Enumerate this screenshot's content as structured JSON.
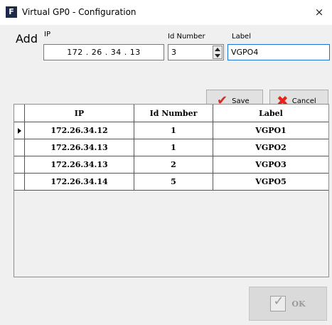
{
  "window": {
    "icon_letter": "F",
    "title": "Virtual GP0 - Configuration",
    "close_symbol": "×"
  },
  "add_form": {
    "section_label": "Add",
    "ip": {
      "label": "IP",
      "value": "172 . 26 . 34 . 13"
    },
    "id_number": {
      "label": "Id Number",
      "value": "3"
    },
    "label": {
      "label": "Label",
      "value": "VGPO4"
    }
  },
  "buttons": {
    "save": "Save",
    "cancel": "Cancel",
    "ok": "OK"
  },
  "grid": {
    "columns": [
      "IP",
      "Id Number",
      "Label"
    ],
    "rows": [
      {
        "ip": "172.26.34.12",
        "id": "1",
        "label": "VGPO1",
        "selected": true
      },
      {
        "ip": "172.26.34.13",
        "id": "1",
        "label": "VGPO2",
        "selected": false
      },
      {
        "ip": "172.26.34.13",
        "id": "2",
        "label": "VGPO3",
        "selected": false
      },
      {
        "ip": "172.26.34.14",
        "id": "5",
        "label": "VGPO5",
        "selected": false
      }
    ]
  },
  "colors": {
    "accent_focus": "#1a73d9",
    "save_icon": "#d42b1e",
    "cancel_icon": "#e0251b",
    "disabled_text": "#9a9a9a"
  }
}
